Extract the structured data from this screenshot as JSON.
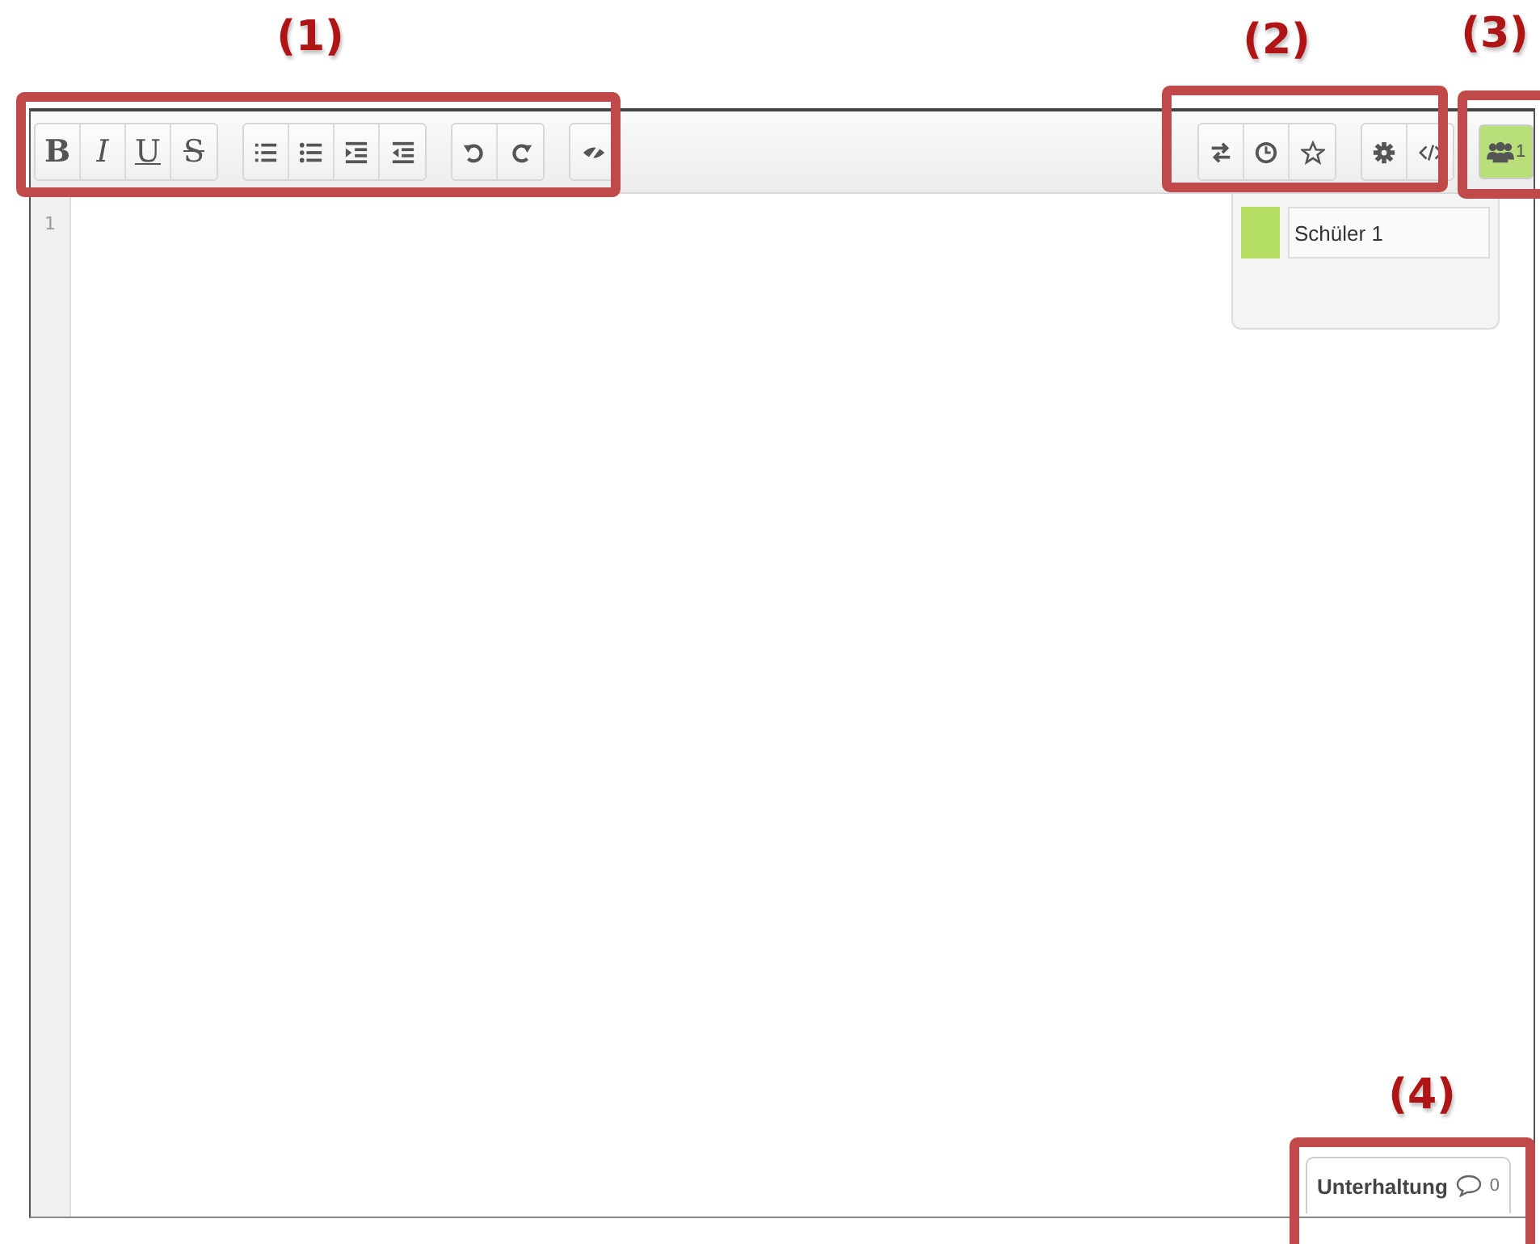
{
  "annotations": [
    {
      "label": "(1)"
    },
    {
      "label": "(2)"
    },
    {
      "label": "(3)"
    },
    {
      "label": "(4)"
    }
  ],
  "toolbar": {
    "left_groups": [
      [
        {
          "kind": "bold",
          "label": "B"
        },
        {
          "kind": "italic",
          "label": "I"
        },
        {
          "kind": "underline",
          "label": "U"
        },
        {
          "kind": "strike",
          "label": "S"
        }
      ],
      [
        {
          "kind": "ordered-list"
        },
        {
          "kind": "bullet-list"
        },
        {
          "kind": "indent"
        },
        {
          "kind": "outdent"
        }
      ],
      [
        {
          "kind": "undo"
        },
        {
          "kind": "redo"
        }
      ],
      [
        {
          "kind": "eye-slash"
        }
      ]
    ],
    "right_groups": [
      [
        {
          "kind": "swap"
        },
        {
          "kind": "clock"
        },
        {
          "kind": "star"
        }
      ],
      [
        {
          "kind": "gear"
        },
        {
          "kind": "code"
        }
      ]
    ],
    "users_button": {
      "count": "1",
      "selected": true
    }
  },
  "editor": {
    "line_numbers": [
      "1"
    ]
  },
  "users_popup": {
    "users": [
      {
        "name": "Schüler 1",
        "color": "#b5df63"
      }
    ]
  },
  "chat_tab": {
    "label": "Unterhaltung",
    "count": "0"
  }
}
